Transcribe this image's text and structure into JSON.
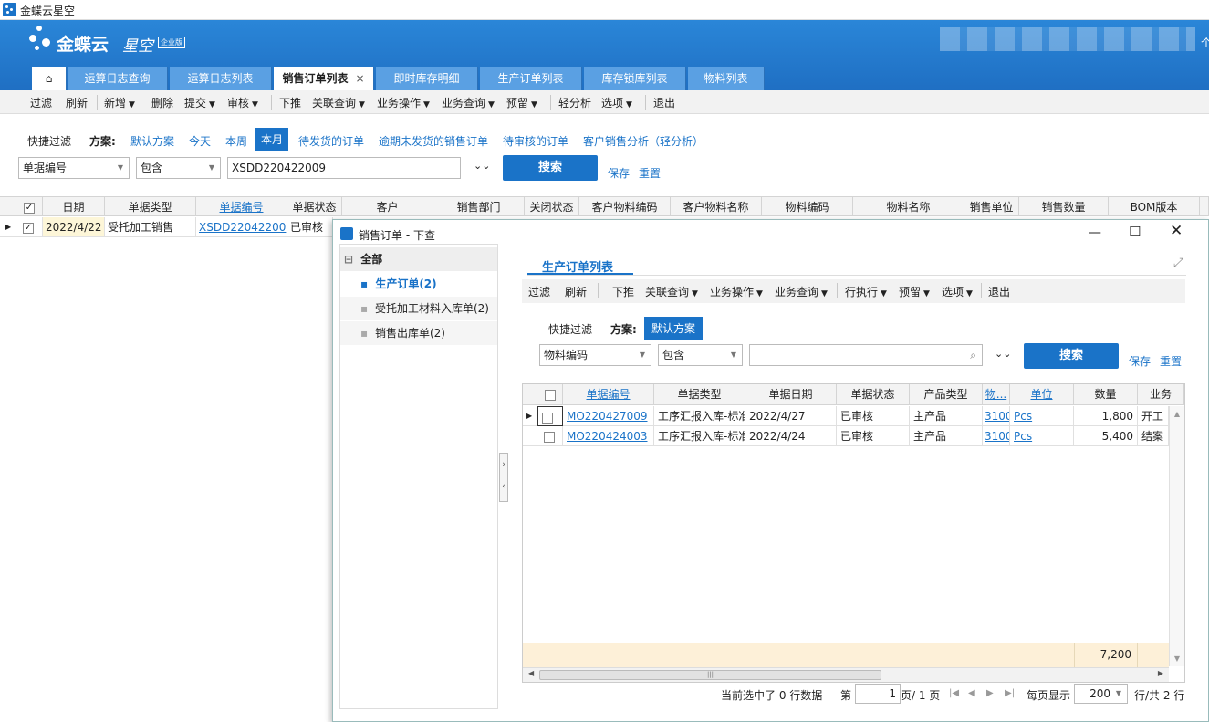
{
  "app": {
    "title": "金蝶云星空",
    "brand": "金蝶云",
    "brand_sub": "星空",
    "edition": "企业版"
  },
  "tabs": [
    {
      "label": "运算日志查询"
    },
    {
      "label": "运算日志列表"
    },
    {
      "label": "销售订单列表"
    },
    {
      "label": "即时库存明细"
    },
    {
      "label": "生产订单列表"
    },
    {
      "label": "库存锁库列表"
    },
    {
      "label": "物料列表"
    }
  ],
  "toolbar": [
    "过滤",
    "刷新",
    "新增",
    "删除",
    "提交",
    "审核",
    "下推",
    "关联查询",
    "业务操作",
    "业务查询",
    "预留",
    "轻分析",
    "选项",
    "退出"
  ],
  "filter": {
    "quick": "快捷过滤",
    "scheme_label": "方案:",
    "schemes": [
      "默认方案",
      "今天",
      "本周",
      "本月",
      "待发货的订单",
      "逾期未发货的销售订单",
      "待审核的订单",
      "客户销售分析（轻分析）"
    ],
    "field": "单据编号",
    "op": "包含",
    "value": "XSDD220422009",
    "search": "搜索",
    "save": "保存",
    "reset": "重置"
  },
  "grid": {
    "headers": [
      "日期",
      "单据类型",
      "单据编号",
      "单据状态",
      "客户",
      "销售部门",
      "关闭状态",
      "客户物料编码",
      "客户物料名称",
      "物料编码",
      "物料名称",
      "销售单位",
      "销售数量",
      "BOM版本"
    ],
    "row": {
      "date": "2022/4/22",
      "type": "受托加工销售",
      "no": "XSDD22042200",
      "status": "已审核"
    }
  },
  "dialog": {
    "title": "销售订单 - 下查",
    "tree": {
      "all": "全部",
      "items": [
        "生产订单(2)",
        "受托加工材料入库单(2)",
        "销售出库单(2)"
      ]
    },
    "tab": "生产订单列表",
    "toolbar": [
      "过滤",
      "刷新",
      "下推",
      "关联查询",
      "业务操作",
      "业务查询",
      "行执行",
      "预留",
      "选项",
      "退出"
    ],
    "filter": {
      "quick": "快捷过滤",
      "scheme_label": "方案:",
      "scheme": "默认方案",
      "field": "物料编码",
      "op": "包含",
      "search": "搜索",
      "save": "保存",
      "reset": "重置"
    },
    "headers": [
      "单据编号",
      "单据类型",
      "单据日期",
      "单据状态",
      "产品类型",
      "物...",
      "单位",
      "数量",
      "业务"
    ],
    "rows": [
      {
        "no": "MO220427009",
        "type": "工序汇报入库-标准",
        "date": "2022/4/27",
        "status": "已审核",
        "ptype": "主产品",
        "mat": "3100",
        "unit": "Pcs",
        "qty": "1,800",
        "biz": "开工"
      },
      {
        "no": "MO220424003",
        "type": "工序汇报入库-标准",
        "date": "2022/4/24",
        "status": "已审核",
        "ptype": "主产品",
        "mat": "3100",
        "unit": "Pcs",
        "qty": "5,400",
        "biz": "结案"
      }
    ],
    "total": "7,200",
    "pager": {
      "selected": "当前选中了 0 行数据",
      "page_label": "第",
      "page": "1",
      "page_of": "页/ 1 页",
      "per_page_label": "每页显示",
      "per_page": "200",
      "rows_total": "行/共 2 行"
    }
  }
}
